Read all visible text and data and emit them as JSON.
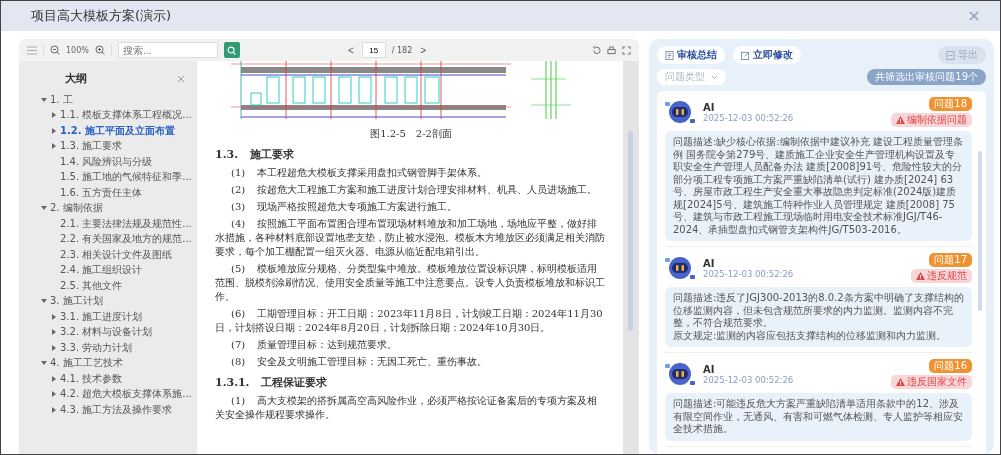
{
  "window": {
    "title": "项目高大模板方案(演示)"
  },
  "toolbar": {
    "zoom": "100%",
    "search_placeholder": "搜索...",
    "page": "15",
    "page_total": "/ 182",
    "prev": "<",
    "next": ">"
  },
  "outline": {
    "title": "大纲",
    "items": [
      {
        "label": "1. 工",
        "expanded": true,
        "selected": false,
        "children": [
          {
            "label": "1.1. 模板支撑体系工程概况...",
            "expanded": false,
            "selected": false
          },
          {
            "label": "1.2. 施工平面及立面布置",
            "expanded": false,
            "selected": true
          },
          {
            "label": "1.3. 施工要求",
            "expanded": false,
            "selected": false
          },
          {
            "label": "1.4. 风险辨识与分级",
            "selected": false
          },
          {
            "label": "1.5. 施工地的气候特征和季...",
            "selected": false
          },
          {
            "label": "1.6. 五方责任主体",
            "selected": false
          }
        ]
      },
      {
        "label": "2. 编制依据",
        "expanded": true,
        "selected": false,
        "children": [
          {
            "label": "2.1. 主要法律法规及规范性...",
            "selected": false
          },
          {
            "label": "2.2. 有关国家及地方的规范...",
            "selected": false
          },
          {
            "label": "2.3. 相关设计文件及图纸",
            "selected": false
          },
          {
            "label": "2.4. 施工组织设计",
            "selected": false
          },
          {
            "label": "2.5. 其他文件",
            "selected": false
          }
        ]
      },
      {
        "label": "3. 施工计划",
        "expanded": true,
        "selected": false,
        "children": [
          {
            "label": "3.1. 施工进度计划",
            "expanded": false,
            "selected": false
          },
          {
            "label": "3.2. 材料与设备计划",
            "expanded": false,
            "selected": false
          },
          {
            "label": "3.3. 劳动力计划",
            "expanded": false,
            "selected": false
          }
        ]
      },
      {
        "label": "4. 施工工艺技术",
        "expanded": true,
        "selected": false,
        "children": [
          {
            "label": "4.1. 技术参数",
            "expanded": false,
            "selected": false
          },
          {
            "label": "4.2. 超危大模板支撑体系施...",
            "expanded": false,
            "selected": false
          },
          {
            "label": "4.3. 施工方法及操作要求",
            "expanded": false,
            "selected": false
          }
        ]
      }
    ]
  },
  "document": {
    "caption": "图1.2-5　2-2剖面",
    "blocks": [
      {
        "kind": "heading",
        "number": "1.3.",
        "text": "施工要求"
      },
      {
        "kind": "para",
        "number": "(1)",
        "text": "本工程超危大模板支撑采用盘扣式钢管脚手架体系。"
      },
      {
        "kind": "para",
        "number": "(2)",
        "text": "按超危大工程施工方案和施工进度计划合理安排材料、机具、人员进场施工。"
      },
      {
        "kind": "para",
        "number": "(3)",
        "text": "现场严格按照超危大专项施工方案进行施工。"
      },
      {
        "kind": "para",
        "number": "(4)",
        "text": "按照施工平面布置图合理布置现场材料堆放和加工场地，场地应平整，做好排水措施，各种材料底部设置地垄支垫，防止被水浸泡。模板木方堆放区必须满足相关消防要求，每个加工棚配置一组灭火器。电源从临近配电箱引出。"
      },
      {
        "kind": "para",
        "number": "(5)",
        "text": "模板堆放应分规格、分类型集中堆放。模板堆放位置设标识牌，标明模板适用范围、脱模剂涂刷情况、使用安全质量等施工中注意要点。设专人负责模板堆放和标识工作。"
      },
      {
        "kind": "para",
        "number": "(6)",
        "text": "工期管理目标：开工日期：2023年11月8日，计划竣工日期：2024年11月30日，计划搭设日期：2024年8月20日，计划拆除日期：2024年10月30日。"
      },
      {
        "kind": "para",
        "number": "(7)",
        "text": "质量管理目标：达到规范要求。"
      },
      {
        "kind": "para",
        "number": "(8)",
        "text": "安全及文明施工管理目标：无因工死亡、重伤事故。"
      },
      {
        "kind": "heading",
        "number": "1.3.1.",
        "text": "工程保证要求"
      },
      {
        "kind": "para",
        "number": "(1)",
        "text": "高大支模架的搭拆属高空高风险作业，必须严格按论证备案后的专项方案及相关安全操作规程要求操作。"
      }
    ]
  },
  "review": {
    "summary_button": "审核总结",
    "modify_button": "立即修改",
    "export_button": {
      "label": "导出",
      "disabled": true
    },
    "filter_placeholder": "问题类型",
    "result_count": "共筛选出审核问题19个",
    "cards": [
      {
        "author": "AI",
        "time": "2025-12-03 00:52:26",
        "issue": "问题18",
        "category": "编制依据问题",
        "description": [
          "问题描述:缺少核心依据:编制依据中建议补充 建设工程质量管理条例 国务院令第279号、建质施工企业安全生产管理机构设置及专职安全生产管理人员配备办法 建质[2008]91号、危险性较大的分部分项工程专项施工方案严重缺陷清单(试行) 建办质[2024] 63号、房屋市政工程生产安全重大事故隐患判定标准(2024版)建质规[2024]5号、建筑施工特种作业人员管理规定 建质[2008] 75号、建筑与市政工程施工现场临时用电安全技术标准JGJ/T46-2024、承插型盘扣式钢管支架构件JG/T503-2016。"
        ]
      },
      {
        "author": "AI",
        "time": "2025-12-03 00:52:26",
        "issue": "问题17",
        "category": "违反规范",
        "description": [
          "问题描述:违反了JGJ300-2013的8.0.2条方案中明确了支撑结构的位移监测内容，但未包含规范所要求的内力监测。监测内容不完整，不符合规范要求。",
          "原文规定:监测的内容应包括支撑结构的位移监测和内力监测。"
        ]
      },
      {
        "author": "AI",
        "time": "2025-12-03 00:52:26",
        "issue": "问题16",
        "category": "违反国家文件",
        "description": [
          "问题描述:可能违反危大方案严重缺陷清单适用条款中的12、涉及有限空间作业，无通风、有害和可燃气体检测、专人监护等相应安全技术措施。"
        ]
      }
    ]
  }
}
